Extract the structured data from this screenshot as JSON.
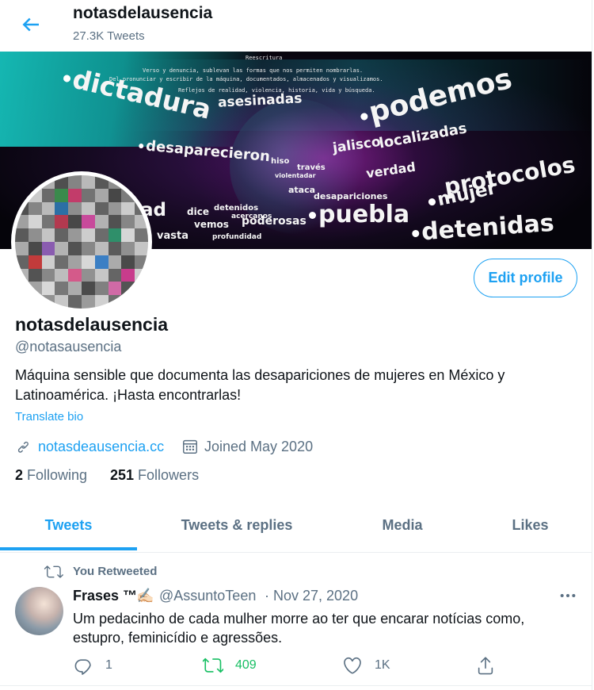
{
  "header": {
    "title": "notasdelausencia",
    "subtitle": "27.3K Tweets"
  },
  "banner": {
    "words": [
      "dictadura",
      "asesinadas",
      "podemos",
      "jalisco",
      "localizadas",
      "desaparecieron",
      "hiso",
      "través",
      "verdad",
      "protocolos",
      "mujer",
      "ad",
      "dice",
      "detenidos",
      "acercanos",
      "ataca",
      "desapariciones",
      "puebla",
      "detenidas",
      "vasta",
      "vemos",
      "profundidad",
      "poderosas",
      "violentadar",
      "Reescritura"
    ],
    "caption_lines": [
      "Verso y denuncia, sublevan las formas que nos permiten nombrarlas.",
      "Del pronunciar y escribir de la máquina, documentados, almacenados y visualizamos.",
      "Reflejos de realidad, violencia, historia, vida y búsqueda."
    ]
  },
  "profile": {
    "edit_label": "Edit profile",
    "name": "notasdelausencia",
    "handle": "@notasausencia",
    "bio": "Máquina sensible que documenta las desapariciones de mujeres en México y Latinoamérica. ¡Hasta encontrarlas!",
    "translate_label": "Translate bio",
    "website": "notasdeausencia.cc",
    "joined": "Joined May 2020",
    "following_count": "2",
    "following_label": "Following",
    "followers_count": "251",
    "followers_label": "Followers"
  },
  "tabs": [
    {
      "label": "Tweets",
      "active": true
    },
    {
      "label": "Tweets & replies",
      "active": false
    },
    {
      "label": "Media",
      "active": false
    },
    {
      "label": "Likes",
      "active": false
    }
  ],
  "tweet": {
    "retweet_context": "You Retweeted",
    "author_name": "Frases ™",
    "author_emoji": "✍🏻",
    "author_handle": "@AssuntoTeen",
    "separator": "·",
    "date": "Nov 27, 2020",
    "text": "Um pedacinho de cada mulher morre ao ter que encarar notícias como, estupro, feminicídio e agressões.",
    "replies": "1",
    "retweets": "409",
    "likes": "1K"
  },
  "colors": {
    "accent": "#1da1f2",
    "retweet_green": "#17bf63",
    "secondary_text": "#5b7083",
    "primary_text": "#0f1419"
  },
  "icons": [
    "back-arrow-icon",
    "link-icon",
    "calendar-icon",
    "retweet-icon",
    "more-icon",
    "reply-icon",
    "like-icon",
    "share-icon"
  ]
}
